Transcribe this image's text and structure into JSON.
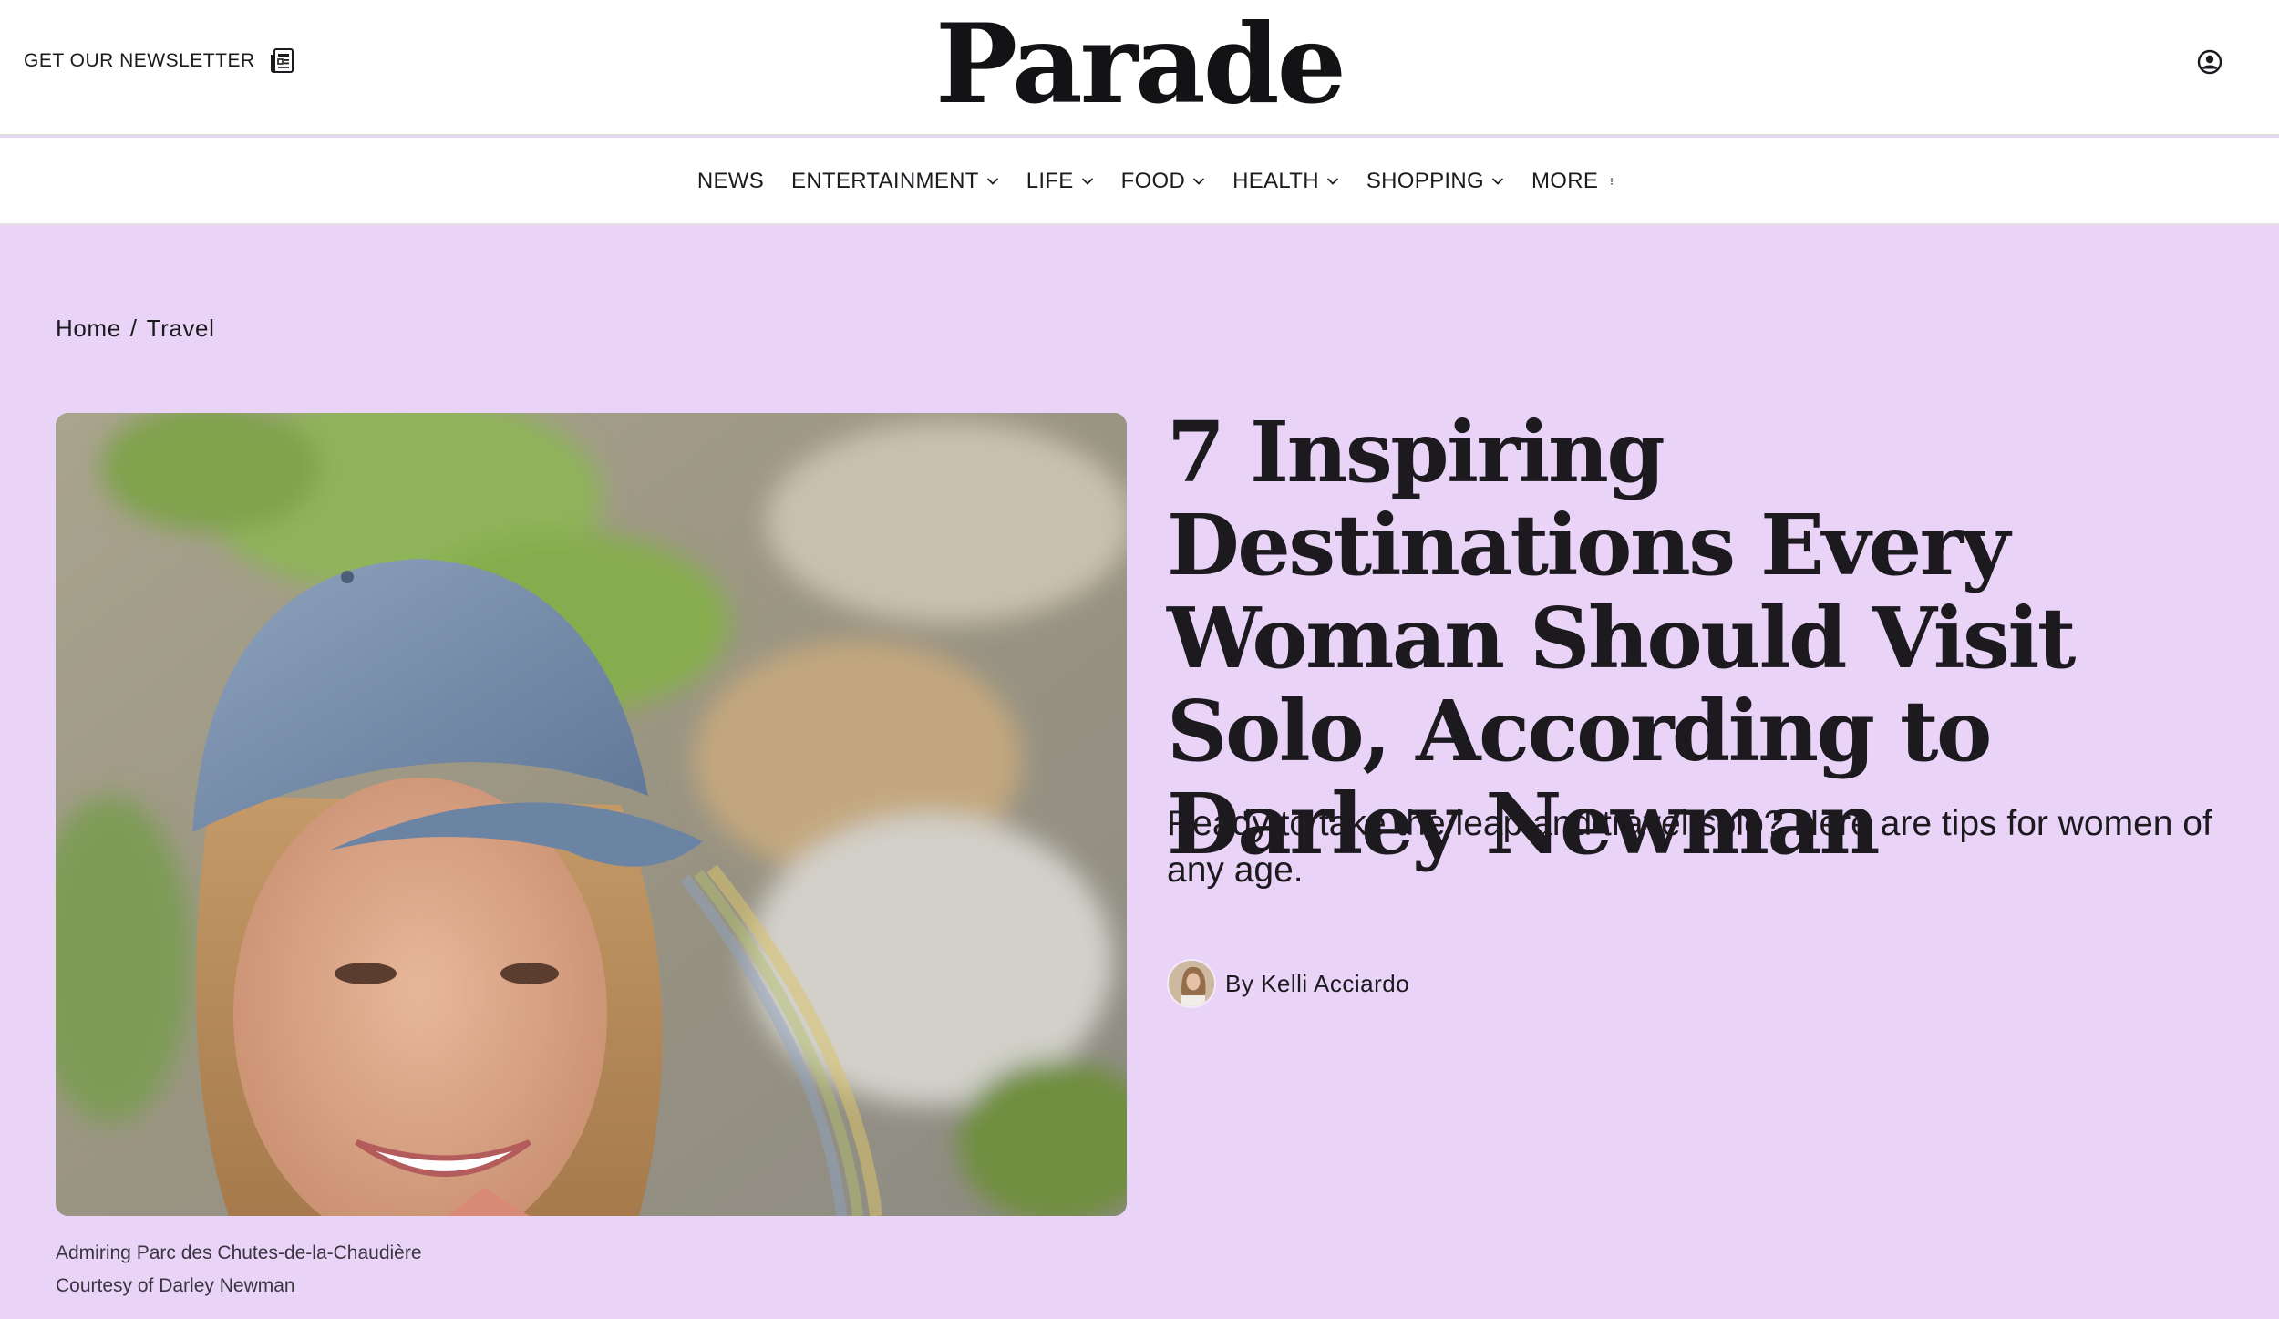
{
  "header": {
    "newsletter_label": "GET OUR NEWSLETTER",
    "logo": "Parade"
  },
  "nav": {
    "items": [
      {
        "label": "NEWS",
        "dropdown": false
      },
      {
        "label": "ENTERTAINMENT",
        "dropdown": true
      },
      {
        "label": "LIFE",
        "dropdown": true
      },
      {
        "label": "FOOD",
        "dropdown": true
      },
      {
        "label": "HEALTH",
        "dropdown": true
      },
      {
        "label": "SHOPPING",
        "dropdown": true
      },
      {
        "label": "MORE",
        "dropdown": false
      }
    ]
  },
  "breadcrumb": {
    "home": "Home",
    "separator": "/",
    "section": "Travel"
  },
  "article": {
    "title": "7 Inspiring Destinations Every Woman Should Visit Solo, According to Darley Newman",
    "dek": "Ready to take the leap and travel solo? Here are tips for women of any age.",
    "byline_prefix": "By",
    "author": "Kelli Acciardo",
    "image_caption": "Admiring Parc des Chutes-de-la-Chaudière",
    "image_credit": "Courtesy of Darley Newman"
  },
  "colors": {
    "page_background": "#e9d4f8",
    "text": "#1c1a1f",
    "header_background": "#ffffff"
  },
  "icons": {
    "newsletter": "newspaper-icon",
    "account": "user-circle-icon",
    "dropdown": "chevron-down-icon",
    "more": "vertical-dots-icon"
  }
}
